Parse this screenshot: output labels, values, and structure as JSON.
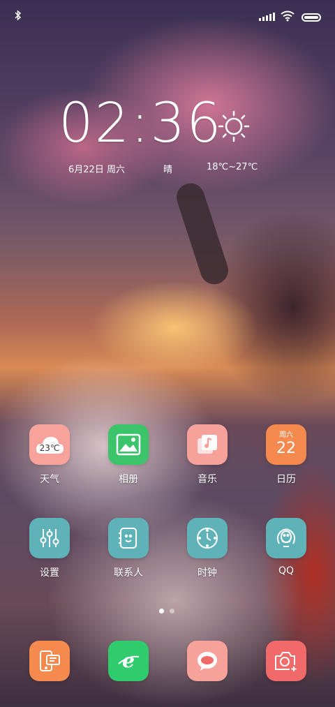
{
  "status_bar": {
    "bluetooth_icon": "bluetooth-icon",
    "signal_icon": "signal-icon",
    "wifi_icon": "wifi-icon",
    "battery_icon": "battery-icon"
  },
  "widget": {
    "time": "02:36",
    "date": "6月22日 周六",
    "weather": "晴",
    "temp_range": "18℃~27℃",
    "weather_icon": "sun-icon"
  },
  "apps_row1": [
    {
      "label": "天气",
      "icon": "weather-icon",
      "badge": "23℃",
      "color": "#F7A29A"
    },
    {
      "label": "相册",
      "icon": "gallery-icon",
      "color": "#3CC46A"
    },
    {
      "label": "音乐",
      "icon": "music-icon",
      "color": "#F6A29B"
    },
    {
      "label": "日历",
      "icon": "calendar-icon",
      "weekday": "周六",
      "day": "22",
      "color": "#F58A4F"
    }
  ],
  "apps_row2": [
    {
      "label": "设置",
      "icon": "settings-icon",
      "color": "#5FB2B8"
    },
    {
      "label": "联系人",
      "icon": "contacts-icon",
      "color": "#5FB2B8"
    },
    {
      "label": "时钟",
      "icon": "clock-icon",
      "color": "#5FB2B8"
    },
    {
      "label": "QQ",
      "icon": "qq-icon",
      "color": "#5FB2B8"
    }
  ],
  "dock": [
    {
      "icon": "messages-icon",
      "color": "#F58A4F"
    },
    {
      "icon": "browser-icon",
      "color": "#2FCB6C"
    },
    {
      "icon": "chat-icon",
      "color": "#F6A29B"
    },
    {
      "icon": "camera-icon",
      "color": "#F16A6A"
    }
  ],
  "page_indicator": {
    "pages": 2,
    "current": 1
  }
}
